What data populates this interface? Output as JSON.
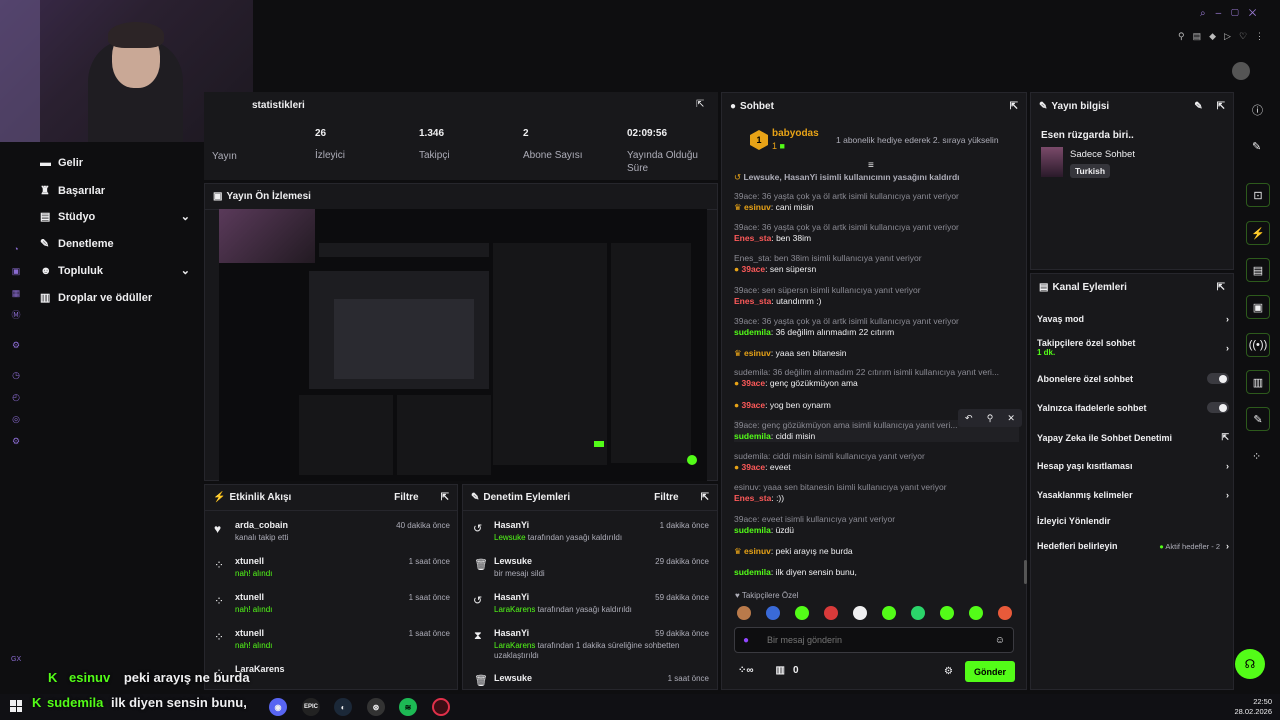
{
  "colors": {
    "accent": "#53fc18",
    "bg": "#0e0e10",
    "panel": "#18181b"
  },
  "sidebar": {
    "items": [
      {
        "label": "Gelir",
        "icon": "money-icon"
      },
      {
        "label": "Başarılar",
        "icon": "trophy-icon"
      },
      {
        "label": "Stüdyo",
        "icon": "grid-icon"
      },
      {
        "label": "Denetleme",
        "icon": "gavel-icon"
      },
      {
        "label": "Topluluk",
        "icon": "people-icon"
      },
      {
        "label": "Droplar ve ödüller",
        "icon": "gift-icon"
      }
    ]
  },
  "stats": {
    "title": "statistikleri",
    "items": [
      {
        "value": "",
        "label": "Yayın"
      },
      {
        "value": "26",
        "label": "İzleyici"
      },
      {
        "value": "1.346",
        "label": "Takipçi"
      },
      {
        "value": "2",
        "label": "Abone Sayısı"
      },
      {
        "value": "02:09:56",
        "label": "Yayında Olduğu Süre"
      }
    ]
  },
  "preview": {
    "title": "Yayın Ön İzlemesi"
  },
  "activity": {
    "title": "Etkinlik Akışı",
    "filter": "Filtre",
    "items": [
      {
        "user": "arda_cobain",
        "detail": "kanalı takip etti",
        "time": "40 dakika önce"
      },
      {
        "user": "xtunell",
        "detail": "nah! alındı",
        "time": "1 saat önce"
      },
      {
        "user": "xtunell",
        "detail": "nah! alındı",
        "time": "1 saat önce"
      },
      {
        "user": "xtunell",
        "detail": "nah! alındı",
        "time": "1 saat önce"
      },
      {
        "user": "LaraKarens",
        "detail": "",
        "time": ""
      }
    ]
  },
  "moderation": {
    "title": "Denetim Eylemleri",
    "filter": "Filtre",
    "items": [
      {
        "user": "HasanYi",
        "actor": "Lewsuke",
        "detail": " tarafından yasağı kaldırıldı",
        "time": "1 dakika önce"
      },
      {
        "user": "Lewsuke",
        "actor": "",
        "detail": "bir mesajı sildi",
        "time": "29 dakika önce"
      },
      {
        "user": "HasanYi",
        "actor": "LaraKarens",
        "detail": " tarafından yasağı kaldırıldı",
        "time": "59 dakika önce"
      },
      {
        "user": "HasanYi",
        "actor": "LaraKarens",
        "detail": " tarafından 1 dakika süreliğine sohbetten uzaklaştırıldı",
        "time": "59 dakika önce"
      },
      {
        "user": "Lewsuke",
        "actor": "",
        "detail": "",
        "time": "1 saat önce"
      }
    ]
  },
  "chat": {
    "title": "Sohbet",
    "pinned_user": "babyodas",
    "pinned_count": "1",
    "pinned_text": "1 abonelik hediye ederek 2. sıraya yükselin",
    "system": "Lewsuke, HasanYi isimli kullanıcının yasağını kaldırdı",
    "lines": [
      {
        "reply": "39ace: 36 yaşta çok ya öl artk isimli kullanıcıya yanıt veriyor",
        "user": "esinuv",
        "msg": ": cani misin"
      },
      {
        "reply": "39ace: 36 yaşta çok ya öl artk isimli kullanıcıya yanıt veriyor",
        "user": "Enes_sta",
        "msg": ": ben 38im"
      },
      {
        "reply": "Enes_sta: ben 38im isimli kullanıcıya yanıt veriyor",
        "user": "39ace",
        "msg": ": sen süpersn"
      },
      {
        "reply": "39ace: sen süpersn isimli kullanıcıya yanıt veriyor",
        "user": "Enes_sta",
        "msg": ": utandımm :)"
      },
      {
        "reply": "39ace: 36 yaşta çok ya öl artk isimli kullanıcıya yanıt veriyor",
        "user": "sudemila",
        "msg": ": 36 değilim alınmadım 22 cıtırım"
      },
      {
        "reply": "",
        "user": "esinuv",
        "msg": ": yaaa sen bitanesin"
      },
      {
        "reply": "sudemila: 36 değilim alınmadım 22 cıtırım isimli kullanıcıya yanıt veri...",
        "user": "39ace",
        "msg": ": genç gözükmüyon ama"
      },
      {
        "reply": "",
        "user": "39ace",
        "msg": ": yog ben oynarm"
      },
      {
        "reply": "39ace: genç gözükmüyon ama isimli kullanıcıya yanıt veri...",
        "user": "sudemila",
        "msg": ": ciddi misin"
      },
      {
        "reply": "sudemila: ciddi misin isimli kullanıcıya yanıt veriyor",
        "user": "39ace",
        "msg": ": eveet"
      },
      {
        "reply": "esinuv: yaaa sen bitanesin isimli kullanıcıya yanıt veriyor",
        "user": "Enes_sta",
        "msg": ": :))"
      },
      {
        "reply": "39ace: eveet isimli kullanıcıya yanıt veriyor",
        "user": "sudemila",
        "msg": ": üzdü"
      },
      {
        "reply": "",
        "user": "esinuv",
        "msg": ": peki arayış ne burda"
      },
      {
        "reply": "",
        "user": "sudemila",
        "msg": ": ilk diyen sensin bunu,"
      }
    ],
    "emote_label": "Takipçilere Özel",
    "input_placeholder": "Bir mesaj gönderin",
    "points": "0",
    "send_label": "Gönder"
  },
  "stream_info": {
    "title": "Yayın bilgisi",
    "stream_title": "Esen rüzgarda biri..",
    "category": "Sadece Sohbet",
    "tag": "Turkish"
  },
  "channel_actions": {
    "title": "Kanal Eylemleri",
    "items": [
      {
        "label": "Yavaş mod",
        "sub": ""
      },
      {
        "label": "Takipçilere özel sohbet",
        "sub": "1 dk."
      },
      {
        "label": "Abonelere özel sohbet",
        "sub": ""
      },
      {
        "label": "Yalnızca ifadelerle sohbet",
        "sub": ""
      },
      {
        "label": "Yapay Zeka ile Sohbet Denetimi",
        "sub": ""
      },
      {
        "label": "Hesap yaşı kısıtlaması",
        "sub": ""
      },
      {
        "label": "Yasaklanmış kelimeler",
        "sub": ""
      },
      {
        "label": "İzleyici Yönlendir",
        "sub": ""
      },
      {
        "label": "Hedefleri belirleyin",
        "sub": ""
      }
    ],
    "goals_status": "Aktif hedefler - 2"
  },
  "overlay": {
    "line1_user": "esinuv",
    "line1_msg": "peki arayış ne burda",
    "line2_user": "sudemila",
    "line2_msg": "ilk diyen sensin bunu,"
  },
  "taskbar": {
    "time": "22:50",
    "date": "28.02.2026"
  }
}
